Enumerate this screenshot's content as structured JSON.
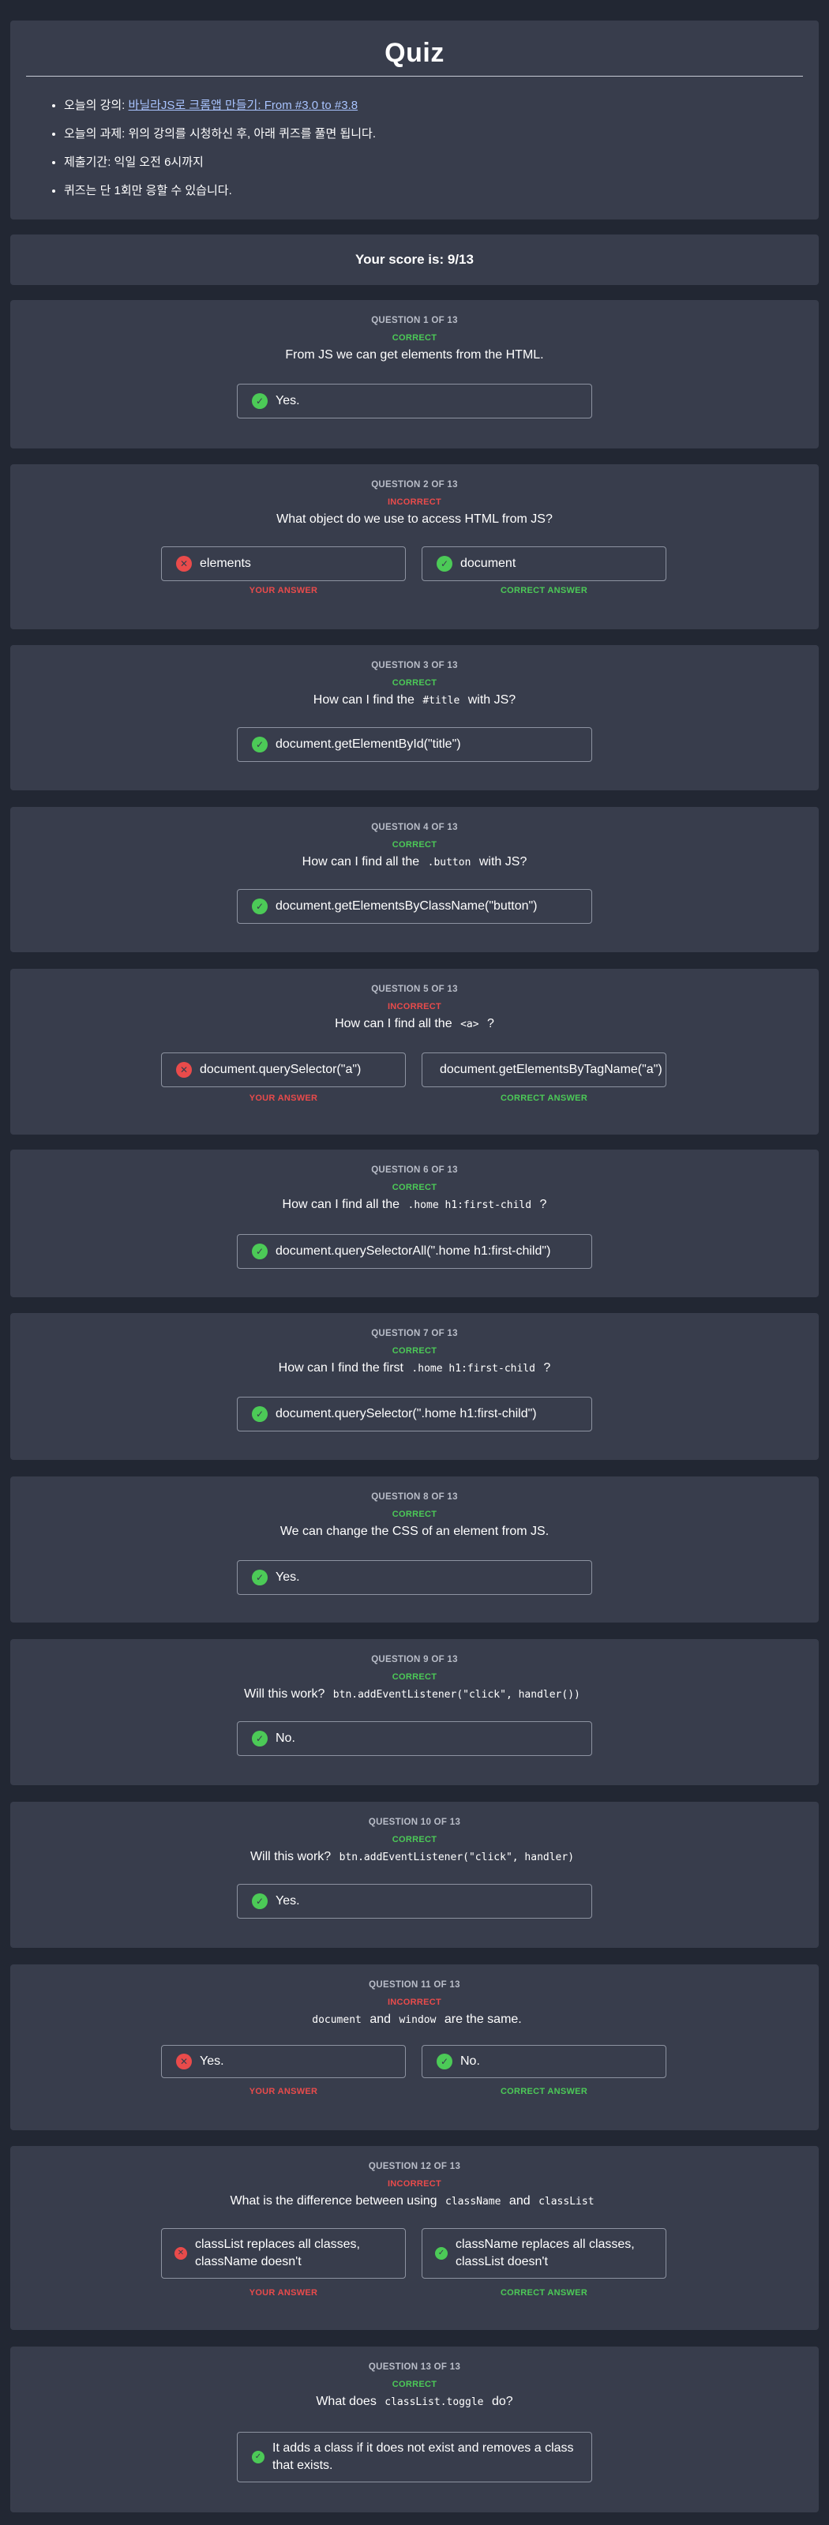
{
  "header": {
    "title": "Quiz",
    "items": [
      {
        "prefix": "오늘의 강의: ",
        "link": "바닐라JS로 크롬앱 만들기: From #3.0 to #3.8"
      },
      {
        "text": "오늘의 과제: 위의 강의를 시청하신 후, 아래 퀴즈를 풀면 됩니다."
      },
      {
        "text": "제출기간: 익일 오전 6시까지"
      },
      {
        "text": "퀴즈는 단 1회만 응할 수 있습니다."
      }
    ]
  },
  "score": "Your score is: 9/13",
  "labels": {
    "your_answer": "YOUR ANSWER",
    "correct_answer": "CORRECT ANSWER"
  },
  "questions": [
    {
      "num": "QUESTION 1 OF 13",
      "status": "CORRECT",
      "text": "From JS we can get elements from the HTML.",
      "answer": "Yes."
    },
    {
      "num": "QUESTION 2 OF 13",
      "status": "INCORRECT",
      "text": "What object do we use to access HTML from JS?",
      "your": "elements",
      "correct": "document"
    },
    {
      "num": "QUESTION 3 OF 13",
      "status": "CORRECT",
      "pre": "How can I find the",
      "code": "#title",
      "post": "with JS?",
      "answer": "document.getElementById(\"title\")"
    },
    {
      "num": "QUESTION 4 OF 13",
      "status": "CORRECT",
      "pre": "How can I find all the",
      "code": ".button",
      "post": "with JS?",
      "answer": "document.getElementsByClassName(\"button\")"
    },
    {
      "num": "QUESTION 5 OF 13",
      "status": "INCORRECT",
      "pre": "How can I find all the",
      "code": "<a>",
      "post": "?",
      "your": "document.querySelector(\"a\")",
      "correct": "document.getElementsByTagName(\"a\")"
    },
    {
      "num": "QUESTION 6 OF 13",
      "status": "CORRECT",
      "pre": "How can I find all the",
      "code": ".home h1:first-child",
      "post": "?",
      "answer": "document.querySelectorAll(\".home h1:first-child\")"
    },
    {
      "num": "QUESTION 7 OF 13",
      "status": "CORRECT",
      "pre": "How can I find the first",
      "code": ".home h1:first-child",
      "post": "?",
      "answer": "document.querySelector(\".home h1:first-child\")"
    },
    {
      "num": "QUESTION 8 OF 13",
      "status": "CORRECT",
      "text": "We can change the CSS of an element from JS.",
      "answer": "Yes."
    },
    {
      "num": "QUESTION 9 OF 13",
      "status": "CORRECT",
      "pre": "Will this work?",
      "code": "btn.addEventListener(\"click\", handler())",
      "answer": "No."
    },
    {
      "num": "QUESTION 10 OF 13",
      "status": "CORRECT",
      "pre": "Will this work?",
      "code": "btn.addEventListener(\"click\", handler)",
      "answer": "Yes."
    },
    {
      "num": "QUESTION 11 OF 13",
      "status": "INCORRECT",
      "code1": "document",
      "mid": "and",
      "code2": "window",
      "post": "are the same.",
      "your": "Yes.",
      "correct": "No."
    },
    {
      "num": "QUESTION 12 OF 13",
      "status": "INCORRECT",
      "pre": "What is the difference between using",
      "code1": "className",
      "mid": "and",
      "code2": "classList",
      "your": "classList replaces all classes, className doesn't",
      "correct": "className replaces all classes, classList doesn't"
    },
    {
      "num": "QUESTION 13 OF 13",
      "status": "CORRECT",
      "pre": "What does",
      "code": "classList.toggle",
      "post": "do?",
      "answer": "It adds a class if it does not exist and removes a class that exists."
    }
  ],
  "colors": {
    "background": "#222733",
    "card": "#383d4c",
    "correct": "#4cca57",
    "incorrect": "#e94b4b",
    "link": "#a9c4ff"
  },
  "icons": {
    "correct": "check-circle-icon",
    "incorrect": "x-circle-icon"
  }
}
